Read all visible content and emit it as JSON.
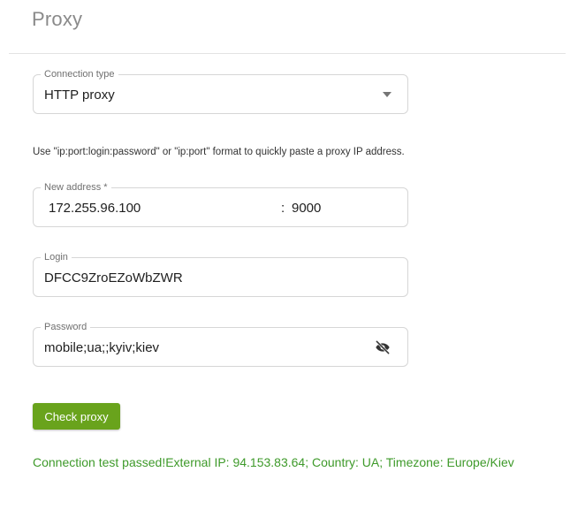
{
  "page": {
    "title": "Proxy"
  },
  "connection_type": {
    "label": "Connection type",
    "value": "HTTP proxy"
  },
  "hint": "Use \"ip:port:login:password\" or \"ip:port\" format to quickly paste a proxy IP address.",
  "address": {
    "label": "New address *",
    "host": "172.255.96.100",
    "separator": ":",
    "port": "9000"
  },
  "login": {
    "label": "Login",
    "value": "DFCC9ZroEZoWbZWR"
  },
  "password": {
    "label": "Password",
    "value": "mobile;ua;;kyiv;kiev",
    "visibility_icon": "eye-off-icon"
  },
  "check_button": {
    "label": "Check proxy"
  },
  "result": {
    "text": "Connection test passed!External IP: 94.153.83.64; Country: UA; Timezone: Europe/Kiev"
  },
  "colors": {
    "accent": "#69a31c",
    "success_text": "#3e9a2a",
    "title": "#8a8a8a",
    "border": "#d6d6d6"
  }
}
